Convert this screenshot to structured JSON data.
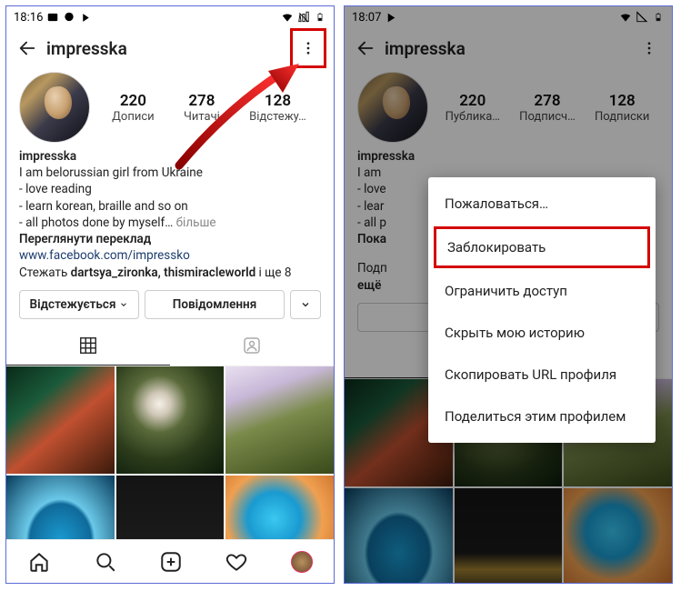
{
  "left": {
    "status": {
      "time": "18:16"
    },
    "header": {
      "username": "impresska"
    },
    "stats": [
      {
        "num": "220",
        "label": "Дописи"
      },
      {
        "num": "278",
        "label": "Читачі"
      },
      {
        "num": "128",
        "label": "Відстежу…"
      }
    ],
    "bio": {
      "username": "impresska",
      "line1": "I am belorussian girl from Ukraine",
      "line2": "- love reading",
      "line3": "- learn korean, braille and so on",
      "line4": "- all photos done by myself…",
      "more": "більше",
      "translate": "Переглянути переклад",
      "link": "www.facebook.com/impressko",
      "follow_prefix": "Стежать ",
      "follow_names": "dartsya_zironka, thismiracleworld",
      "follow_suffix": " і ще 8"
    },
    "buttons": {
      "following": "Відстежується",
      "message": "Повідомлення"
    }
  },
  "right": {
    "status": {
      "time": "18:07"
    },
    "header": {
      "username": "impresska"
    },
    "stats": [
      {
        "num": "220",
        "label": "Публика…"
      },
      {
        "num": "278",
        "label": "Подписч…"
      },
      {
        "num": "128",
        "label": "Подписки"
      }
    ],
    "bio": {
      "username": "impresska",
      "line1": "I am",
      "line2": "- love",
      "line3": "- lear",
      "line4": "- all p",
      "more2": "Пока",
      "follow_prefix": "Подп",
      "follow_suffix2": "ещё"
    },
    "menu": [
      "Пожаловаться…",
      "Заблокировать",
      "Ограничить доступ",
      "Скрыть мою историю",
      "Скопировать URL профиля",
      "Поделиться этим профилем"
    ]
  }
}
